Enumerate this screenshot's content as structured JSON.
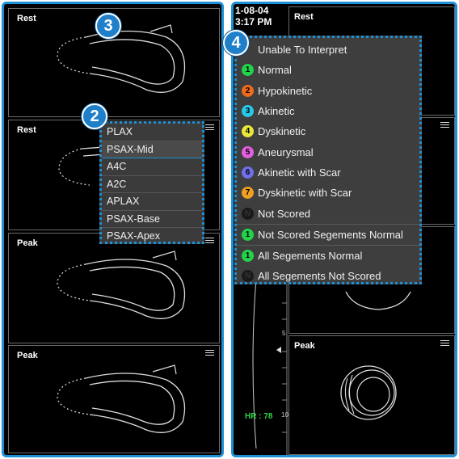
{
  "left": {
    "cells": [
      {
        "label": "Rest",
        "menu": false
      },
      {
        "label": "Rest",
        "menu": true
      },
      {
        "label": "Peak",
        "menu": true
      },
      {
        "label": "Peak",
        "menu": true
      }
    ]
  },
  "right": {
    "date": "1-08-04",
    "time": "3:17 PM",
    "top_label": "Rest",
    "peak_label": "Peak",
    "hr": "HR : 78",
    "scale_5": "5",
    "scale_10": "10"
  },
  "badges": {
    "b3": "3",
    "b2": "2",
    "b4": "4"
  },
  "view_dropdown": {
    "items": [
      "PLAX",
      "PSAX-Mid",
      "A4C",
      "A2C",
      "APLAX",
      "PSAX-Base",
      "PSAX-Apex"
    ],
    "selected": "PSAX-Mid"
  },
  "score_menu": {
    "items": [
      {
        "num": "",
        "label": "Unable To Interpret",
        "color": ""
      },
      {
        "num": "1",
        "label": "Normal",
        "color": "#22d34a"
      },
      {
        "num": "2",
        "label": "Hypokinetic",
        "color": "#f06a1a"
      },
      {
        "num": "3",
        "label": "Akinetic",
        "color": "#27c9e8"
      },
      {
        "num": "4",
        "label": "Dyskinetic",
        "color": "#e8e83a"
      },
      {
        "num": "5",
        "label": "Aneurysmal",
        "color": "#e25fe0"
      },
      {
        "num": "6",
        "label": "Akinetic with Scar",
        "color": "#6f6fe8"
      },
      {
        "num": "7",
        "label": "Dyskinetic with Scar",
        "color": "#f0a020"
      },
      {
        "num": "N",
        "label": "Not Scored",
        "color": "#1a1a1a"
      },
      {
        "num": "1",
        "label": "Not Scored Segements Normal",
        "color": "#22d34a"
      },
      {
        "num": "1",
        "label": "All Segements Normal",
        "color": "#22d34a"
      },
      {
        "num": "N",
        "label": "All Segements Not Scored",
        "color": "#1a1a1a"
      }
    ]
  }
}
